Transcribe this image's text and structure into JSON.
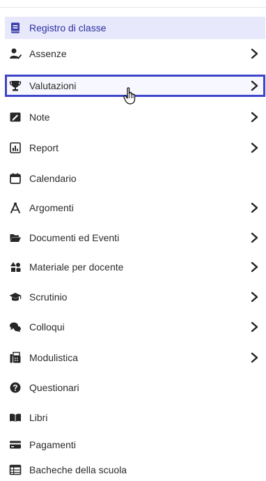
{
  "menu": {
    "items": [
      {
        "label": "Registro di classe",
        "icon": "register-book-icon",
        "chevron": false,
        "state": "active"
      },
      {
        "label": "Assenze",
        "icon": "user-absence-icon",
        "chevron": true,
        "state": "normal"
      },
      {
        "label": "Valutazioni",
        "icon": "trophy-icon",
        "chevron": true,
        "state": "highlighted"
      },
      {
        "label": "Note",
        "icon": "note-icon",
        "chevron": true,
        "state": "normal"
      },
      {
        "label": "Report",
        "icon": "chart-report-icon",
        "chevron": true,
        "state": "normal"
      },
      {
        "label": "Calendario",
        "icon": "calendar-icon",
        "chevron": false,
        "state": "normal"
      },
      {
        "label": "Argomenti",
        "icon": "compass-icon",
        "chevron": true,
        "state": "normal"
      },
      {
        "label": "Documenti ed Eventi",
        "icon": "folder-open-icon",
        "chevron": true,
        "state": "normal"
      },
      {
        "label": "Materiale per docente",
        "icon": "shapes-icon",
        "chevron": true,
        "state": "normal"
      },
      {
        "label": "Scrutinio",
        "icon": "graduation-cap-icon",
        "chevron": true,
        "state": "normal"
      },
      {
        "label": "Colloqui",
        "icon": "comments-icon",
        "chevron": true,
        "state": "normal"
      },
      {
        "label": "Modulistica",
        "icon": "fax-icon",
        "chevron": true,
        "state": "normal"
      },
      {
        "label": "Questionari",
        "icon": "question-circle-icon",
        "chevron": false,
        "state": "normal"
      },
      {
        "label": "Libri",
        "icon": "book-open-icon",
        "chevron": false,
        "state": "normal"
      },
      {
        "label": "Pagamenti",
        "icon": "credit-card-icon",
        "chevron": false,
        "state": "normal"
      },
      {
        "label": "Bacheche della scuola",
        "icon": "board-table-icon",
        "chevron": false,
        "state": "normal"
      }
    ]
  },
  "colors": {
    "active_bg": "#e7e8fb",
    "active_text": "#2d2fa0",
    "highlight_border": "#3d45c8",
    "icon": "#262626"
  }
}
